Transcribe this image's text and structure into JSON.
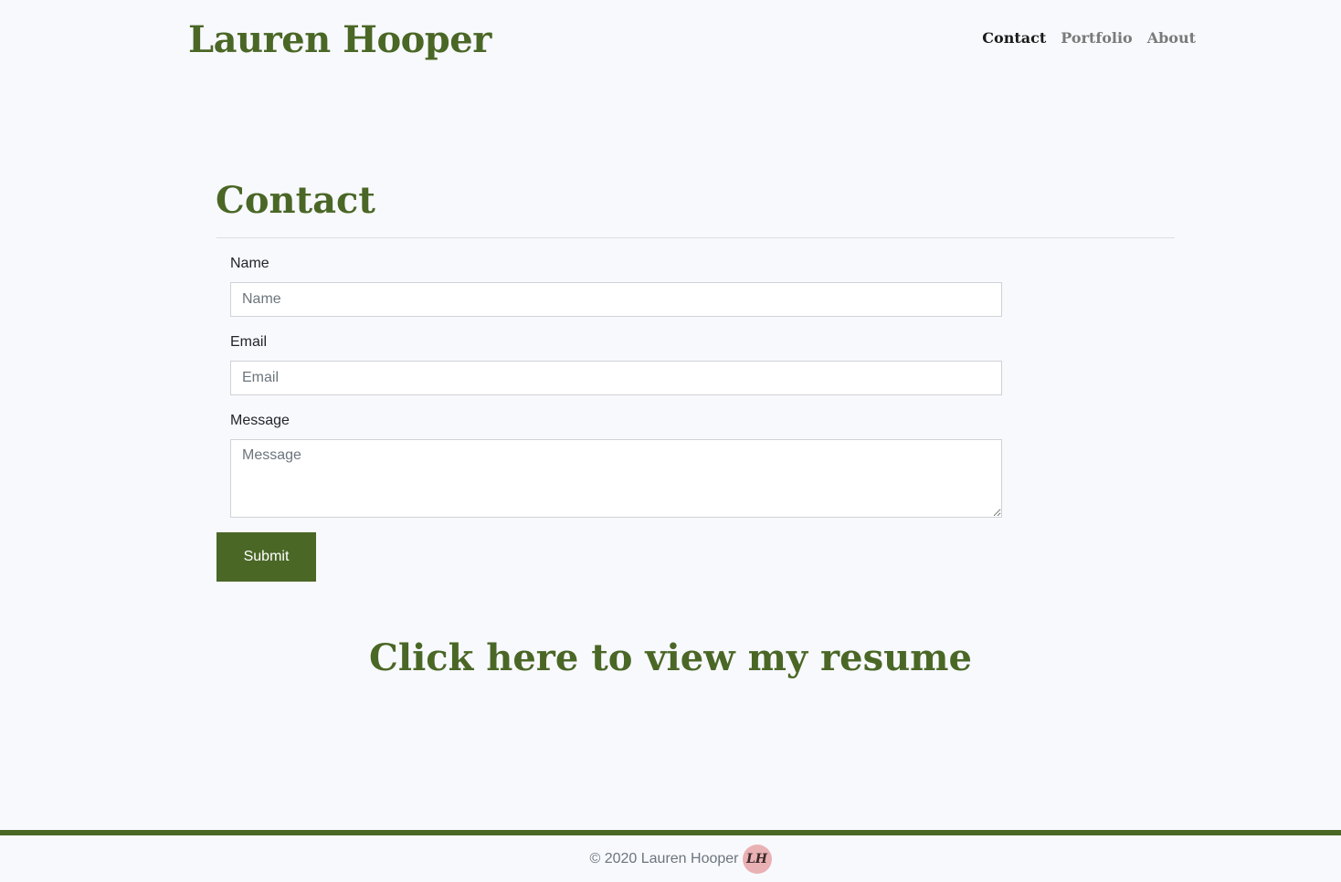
{
  "header": {
    "brand": "Lauren Hooper",
    "nav": [
      {
        "label": "Contact",
        "active": true
      },
      {
        "label": "Portfolio",
        "active": false
      },
      {
        "label": "About",
        "active": false
      }
    ]
  },
  "contact": {
    "title": "Contact",
    "fields": {
      "name": {
        "label": "Name",
        "placeholder": "Name",
        "value": ""
      },
      "email": {
        "label": "Email",
        "placeholder": "Email",
        "value": ""
      },
      "message": {
        "label": "Message",
        "placeholder": "Message",
        "value": ""
      }
    },
    "submit_label": "Submit"
  },
  "resume_link": "Click here to view my resume",
  "footer": {
    "text": "© 2020 Lauren Hooper",
    "logo_initials": "LH"
  },
  "colors": {
    "accent": "#4a6726",
    "background": "#f8f9fd",
    "logo_badge": "#e9b1b4"
  }
}
